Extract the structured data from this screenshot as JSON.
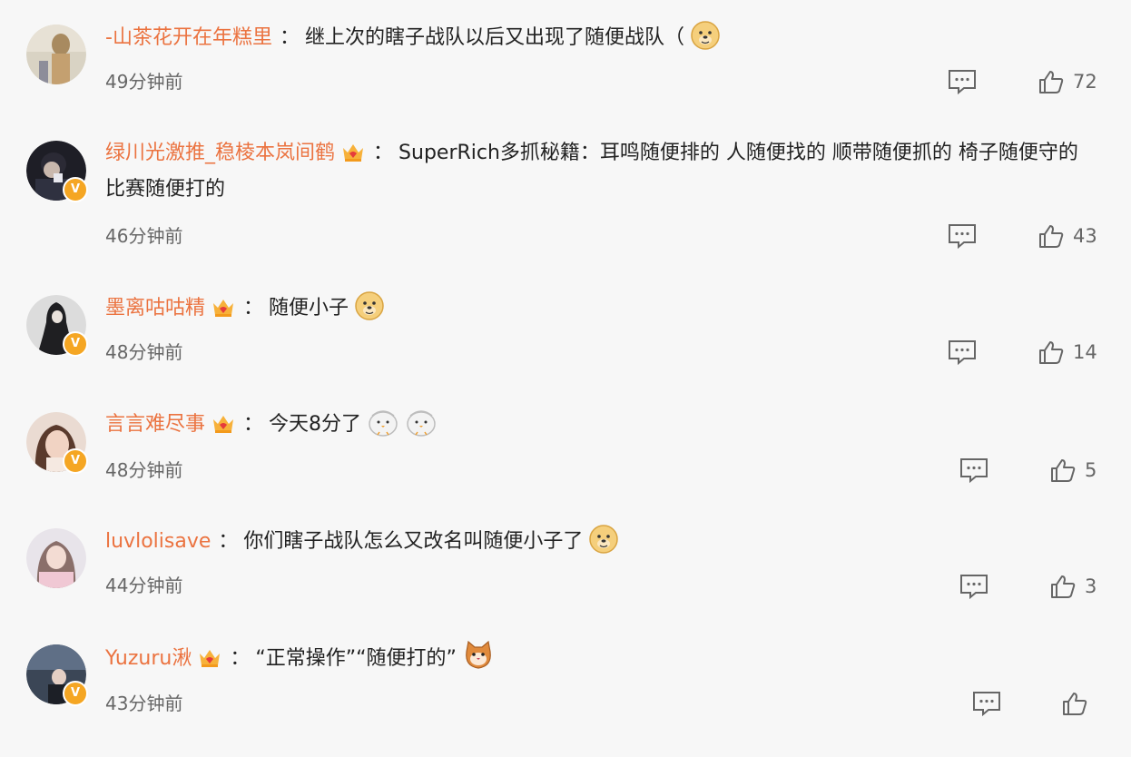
{
  "comments": [
    {
      "username": "-山茶花开在年糕里",
      "colon": "：",
      "text": "继上次的瞎子战队以后又出现了随便战队（",
      "time": "49分钟前",
      "likes": "72"
    },
    {
      "username": "绿川光激推_稳棱本岚间鹤",
      "colon": "：",
      "text": "SuperRich多抓秘籍：耳鸣随便排的 人随便找的 顺带随便抓的 椅子随便守的 比赛随便打的",
      "time": "46分钟前",
      "likes": "43"
    },
    {
      "username": "墨离咕咕精",
      "colon": "：",
      "text": "随便小子",
      "time": "48分钟前",
      "likes": "14"
    },
    {
      "username": "言言难尽事",
      "colon": "：",
      "text": "今天8分了",
      "time": "48分钟前",
      "likes": "5"
    },
    {
      "username": "luvlolisave",
      "colon": "：",
      "text": "你们瞎子战队怎么又改名叫随便小子了",
      "time": "44分钟前",
      "likes": "3"
    },
    {
      "username": "Yuzuru湫",
      "colon": "：",
      "text": "“正常操作”“随便打的”",
      "time": "43分钟前",
      "likes": ""
    }
  ],
  "icons": {
    "reply": "comment-icon",
    "like": "thumbs-up-icon",
    "crown": "crown-badge-icon",
    "verified": "verified-v-icon"
  },
  "badges": {
    "verified_letter": "V"
  },
  "colors": {
    "username": "#eb7340",
    "background": "#f7f7f7",
    "verified": "#f5a623"
  }
}
